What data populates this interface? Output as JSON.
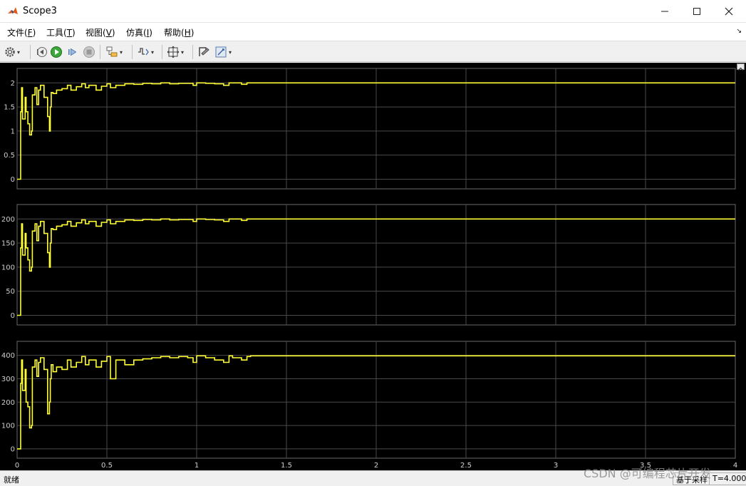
{
  "window": {
    "title": "Scope3",
    "app_icon": "matlab-icon"
  },
  "menu": [
    {
      "label": "文件(",
      "key": "F",
      "tail": ")"
    },
    {
      "label": "工具(",
      "key": "T",
      "tail": ")"
    },
    {
      "label": "视图(",
      "key": "V",
      "tail": ")"
    },
    {
      "label": "仿真(",
      "key": "I",
      "tail": ")"
    },
    {
      "label": "帮助(",
      "key": "H",
      "tail": ")"
    }
  ],
  "toolbar_icons": [
    "gear-icon",
    "step-back-icon",
    "run-icon",
    "step-forward-icon",
    "stop-icon",
    "highlight-block-icon",
    "triggers-icon",
    "zoom-fit-icon",
    "style-icon",
    "edit-icon"
  ],
  "colors": {
    "signal": "#ffff33",
    "grid": "#4a4a4a",
    "plot_bg": "#000000",
    "axes_bg": "#000000",
    "ticks": "#cfcfcf"
  },
  "chart_data": [
    {
      "type": "line",
      "xlim": [
        0,
        4
      ],
      "ylim": [
        -0.2,
        2.3
      ],
      "yticks": [
        "0",
        "0.5",
        "1",
        "1.5",
        "2"
      ],
      "xticks": [],
      "grid": true,
      "series": [
        {
          "x": [
            0,
            0.02,
            0.025,
            0.03,
            0.045,
            0.05,
            0.06,
            0.07,
            0.08,
            0.085,
            0.1,
            0.11,
            0.12,
            0.13,
            0.15,
            0.17,
            0.18,
            0.185,
            0.19,
            0.2,
            0.22,
            0.25,
            0.28,
            0.3,
            0.33,
            0.36,
            0.38,
            0.4,
            0.44,
            0.47,
            0.5,
            0.52,
            0.55,
            0.6,
            0.65,
            0.7,
            0.75,
            0.8,
            0.85,
            0.9,
            0.95,
            0.98,
            1.0,
            1.05,
            1.1,
            1.15,
            1.18,
            1.2,
            1.25,
            1.28,
            1.3,
            4.0
          ],
          "y": [
            0,
            1.4,
            1.9,
            1.25,
            1.7,
            1.4,
            1.15,
            0.92,
            1.0,
            1.75,
            1.9,
            1.55,
            1.85,
            1.95,
            1.7,
            1.3,
            1.0,
            1.5,
            1.8,
            1.78,
            1.85,
            1.88,
            1.95,
            1.85,
            1.92,
            1.98,
            1.9,
            1.95,
            1.85,
            1.93,
            1.98,
            1.9,
            1.95,
            1.98,
            1.97,
            1.99,
            1.98,
            2.0,
            1.98,
            1.99,
            1.99,
            1.95,
            2.0,
            1.99,
            1.98,
            1.95,
            2.0,
            2.0,
            1.97,
            2.0,
            2.0,
            2.0
          ]
        }
      ]
    },
    {
      "type": "line",
      "xlim": [
        0,
        4
      ],
      "ylim": [
        -20,
        230
      ],
      "yticks": [
        "0",
        "50",
        "100",
        "150",
        "200"
      ],
      "xticks": [],
      "grid": true,
      "series": [
        {
          "x": [
            0,
            0.02,
            0.025,
            0.03,
            0.045,
            0.05,
            0.06,
            0.07,
            0.08,
            0.085,
            0.1,
            0.11,
            0.12,
            0.13,
            0.15,
            0.17,
            0.18,
            0.185,
            0.19,
            0.2,
            0.22,
            0.25,
            0.28,
            0.3,
            0.33,
            0.36,
            0.38,
            0.4,
            0.44,
            0.47,
            0.5,
            0.52,
            0.55,
            0.6,
            0.65,
            0.7,
            0.75,
            0.8,
            0.85,
            0.9,
            0.95,
            0.98,
            1.0,
            1.05,
            1.1,
            1.15,
            1.18,
            1.2,
            1.25,
            1.28,
            1.3,
            4.0
          ],
          "y": [
            0,
            140,
            190,
            125,
            170,
            140,
            115,
            92,
            100,
            175,
            190,
            155,
            185,
            195,
            170,
            130,
            100,
            150,
            180,
            178,
            185,
            188,
            195,
            185,
            192,
            198,
            190,
            195,
            185,
            193,
            198,
            190,
            195,
            198,
            197,
            199,
            198,
            200,
            198,
            199,
            199,
            195,
            200,
            199,
            198,
            195,
            200,
            200,
            197,
            200,
            200,
            200
          ]
        }
      ]
    },
    {
      "type": "line",
      "xlim": [
        0,
        4
      ],
      "ylim": [
        -40,
        460
      ],
      "yticks": [
        "0",
        "100",
        "200",
        "300",
        "400"
      ],
      "xticks": [
        "0",
        "0.5",
        "1",
        "1.5",
        "2",
        "2.5",
        "3",
        "3.5",
        "4"
      ],
      "grid": true,
      "series": [
        {
          "x": [
            0,
            0.02,
            0.025,
            0.03,
            0.045,
            0.05,
            0.06,
            0.07,
            0.08,
            0.085,
            0.1,
            0.11,
            0.12,
            0.13,
            0.15,
            0.17,
            0.18,
            0.185,
            0.19,
            0.2,
            0.22,
            0.25,
            0.28,
            0.3,
            0.33,
            0.36,
            0.38,
            0.4,
            0.44,
            0.47,
            0.5,
            0.52,
            0.55,
            0.6,
            0.65,
            0.7,
            0.75,
            0.8,
            0.85,
            0.9,
            0.95,
            0.98,
            1.0,
            1.05,
            1.1,
            1.15,
            1.18,
            1.2,
            1.25,
            1.28,
            1.3,
            4.0
          ],
          "y": [
            0,
            280,
            380,
            250,
            340,
            200,
            180,
            90,
            100,
            350,
            380,
            310,
            370,
            390,
            340,
            150,
            200,
            300,
            360,
            330,
            350,
            340,
            380,
            350,
            370,
            395,
            360,
            380,
            350,
            375,
            395,
            300,
            380,
            360,
            380,
            385,
            390,
            395,
            390,
            395,
            390,
            370,
            398,
            390,
            380,
            370,
            398,
            390,
            380,
            395,
            398,
            398
          ]
        }
      ]
    }
  ],
  "status": {
    "ready": "就绪",
    "sample_based": "基于采样",
    "time": "T=4.000"
  },
  "watermark": "CSDN @可编程芯片开发"
}
